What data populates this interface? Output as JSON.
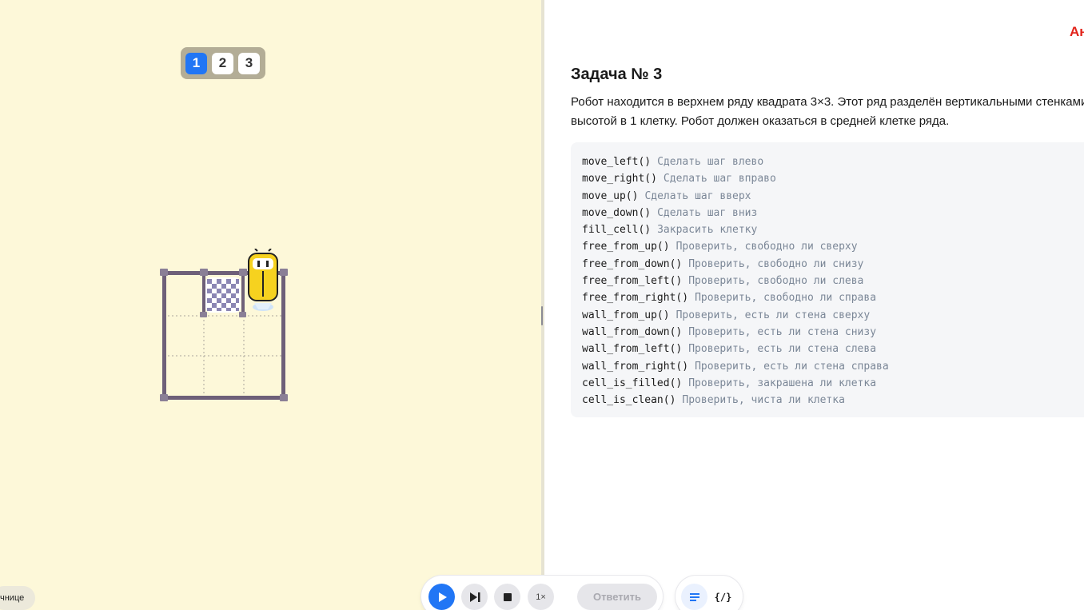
{
  "levels": {
    "tabs": [
      "1",
      "2",
      "3"
    ],
    "active": "1"
  },
  "task": {
    "title": "Задача № 3",
    "description_line1": "Робот находится в верхнем ряду квадрата 3×3. Этот ряд разделён вертикальными стенками",
    "description_line2": "высотой в 1 клетку. Робот должен оказаться в средней клетке ряда."
  },
  "commands": [
    {
      "fn": "move_left()",
      "desc": "Сделать шаг влево"
    },
    {
      "fn": "move_right()",
      "desc": "Сделать шаг вправо"
    },
    {
      "fn": "move_up()",
      "desc": "Сделать шаг вверх"
    },
    {
      "fn": "move_down()",
      "desc": "Сделать шаг вниз"
    },
    {
      "fn": "fill_cell()",
      "desc": "Закрасить клетку"
    },
    {
      "fn": "free_from_up()",
      "desc": "Проверить, свободно ли сверху"
    },
    {
      "fn": "free_from_down()",
      "desc": "Проверить, свободно ли снизу"
    },
    {
      "fn": "free_from_left()",
      "desc": "Проверить, свободно ли слева"
    },
    {
      "fn": "free_from_right()",
      "desc": "Проверить, свободно ли справа"
    },
    {
      "fn": "wall_from_up()",
      "desc": "Проверить, есть ли стена сверху"
    },
    {
      "fn": "wall_from_down()",
      "desc": "Проверить, есть ли стена снизу"
    },
    {
      "fn": "wall_from_left()",
      "desc": "Проверить, есть ли стена слева"
    },
    {
      "fn": "wall_from_right()",
      "desc": "Проверить, есть ли стена справа"
    },
    {
      "fn": "cell_is_filled()",
      "desc": "Проверить, закрашена ли клетка"
    },
    {
      "fn": "cell_is_clean()",
      "desc": "Проверить, чиста ли клетка"
    }
  ],
  "controls": {
    "speed_label": "1×",
    "answer_label": "Ответить"
  },
  "help_pill_label": "чнице",
  "top_right_text": "Ан",
  "colors": {
    "accent": "#2176f5",
    "field_background": "#fdf8d9",
    "wall": "#6e6079",
    "robot": "#f6d21f",
    "target_checker": "#8b86b3"
  },
  "icons": {
    "play": "play-icon",
    "step": "step-forward-icon",
    "stop": "stop-icon",
    "text_mode": "text-lines-icon",
    "code_mode": "code-braces-icon"
  }
}
